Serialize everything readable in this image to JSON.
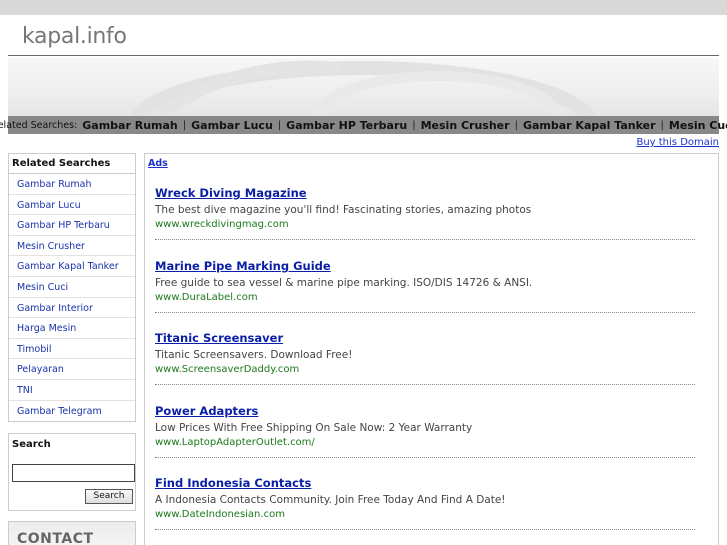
{
  "site": {
    "title": "kapal.info"
  },
  "related_bar": {
    "label": "Related Searches:",
    "links": [
      "Gambar Rumah",
      "Gambar Lucu",
      "Gambar HP Terbaru",
      "Mesin Crusher",
      "Gambar Kapal Tanker",
      "Mesin Cuci"
    ],
    "separator": "|"
  },
  "buy_domain": "Buy this Domain",
  "sidebar": {
    "heading": "Related Searches",
    "items": [
      "Gambar Rumah",
      "Gambar Lucu",
      "Gambar HP Terbaru",
      "Mesin Crusher",
      "Gambar Kapal Tanker",
      "Mesin Cuci",
      "Gambar Interior",
      "Harga Mesin",
      "Timobil",
      "Pelayaran",
      "TNI",
      "Gambar Telegram"
    ]
  },
  "search": {
    "heading": "Search",
    "value": "",
    "button": "Search"
  },
  "contact": {
    "label": "CONTACT"
  },
  "ads": {
    "label": "Ads",
    "items": [
      {
        "title": "Wreck Diving Magazine",
        "desc": "The best dive magazine you'll find! Fascinating stories, amazing photos",
        "url": "www.wreckdivingmag.com"
      },
      {
        "title": "Marine Pipe Marking Guide",
        "desc": "Free guide to sea vessel & marine pipe marking. ISO/DIS 14726 & ANSI.",
        "url": "www.DuraLabel.com"
      },
      {
        "title": "Titanic Screensaver",
        "desc": "Titanic Screensavers. Download Free!",
        "url": "www.ScreensaverDaddy.com"
      },
      {
        "title": "Power Adapters",
        "desc": "Low Prices With Free Shipping On Sale Now: 2 Year Warranty",
        "url": "www.LaptopAdapterOutlet.com/"
      },
      {
        "title": "Find Indonesia Contacts",
        "desc": "A Indonesia Contacts Community. Join Free Today And Find A Date!",
        "url": "www.DateIndonesian.com"
      }
    ]
  },
  "colors": {
    "link": "#0a1fa6",
    "url": "#1c7a1c",
    "bar": "#888888"
  }
}
